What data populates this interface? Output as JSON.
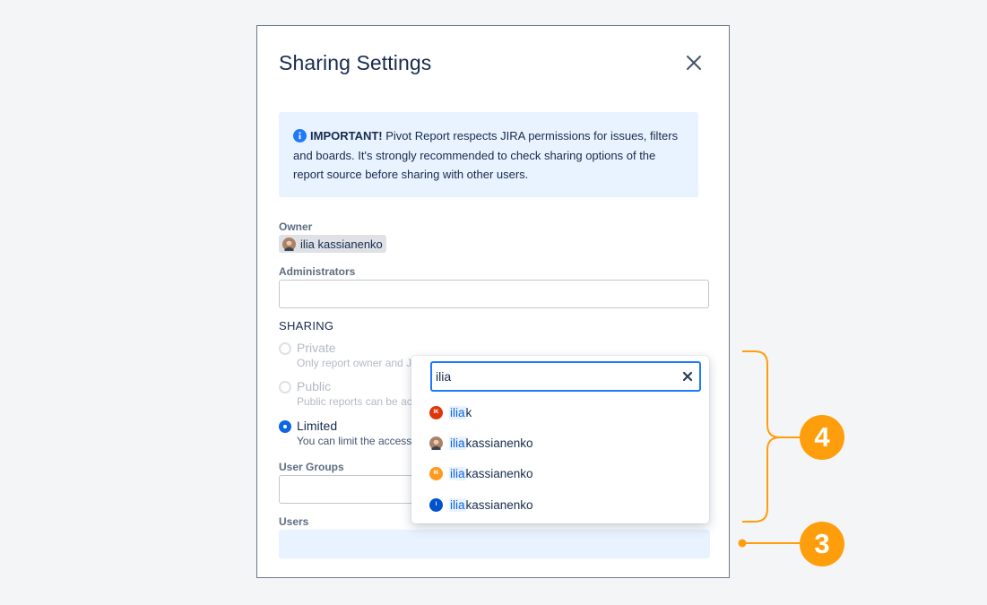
{
  "modal": {
    "title": "Sharing Settings",
    "close_icon": "close-icon"
  },
  "notice": {
    "icon": "info-icon",
    "bold": "IMPORTANT!",
    "text": " Pivot Report respects JIRA permissions for issues, filters and boards. It's strongly recommended to check sharing options of the report source before sharing with other users."
  },
  "owner": {
    "label": "Owner",
    "name": "ilia kassianenko"
  },
  "administrators": {
    "label": "Administrators",
    "value": ""
  },
  "sharing": {
    "heading": "SHARING",
    "options": [
      {
        "label": "Private",
        "description": "Only report owner and J",
        "checked": false,
        "disabled": true
      },
      {
        "label": "Public",
        "description": "Public reports can be ac",
        "checked": false,
        "disabled": true
      },
      {
        "label": "Limited",
        "description": "You can limit the access",
        "checked": true,
        "disabled": false
      }
    ]
  },
  "user_groups": {
    "label": "User Groups",
    "value": ""
  },
  "users": {
    "label": "Users",
    "value": ""
  },
  "dropdown": {
    "search_value": "ilia",
    "clear_icon": "clear-icon",
    "results": [
      {
        "match": "ilia",
        "rest": " k",
        "avatar": "IK",
        "avatar_color": "#de350b"
      },
      {
        "match": "ilia",
        "rest": " kassianenko",
        "avatar": "photo",
        "avatar_color": "#6b4f3a"
      },
      {
        "match": "ilia",
        "rest": " kassianenko",
        "avatar": "IK",
        "avatar_color": "#ff991f"
      },
      {
        "match": "ilia",
        "rest": "kassianenko",
        "avatar": "I",
        "avatar_color": "#0052cc"
      }
    ]
  },
  "annotations": {
    "bracket_badge": "4",
    "pointer_badge": "3",
    "color": "#ff9e0d"
  }
}
